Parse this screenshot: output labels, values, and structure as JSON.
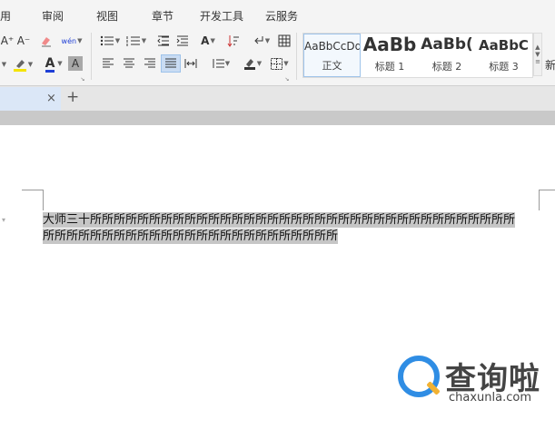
{
  "menubar": {
    "items": [
      "用",
      "审阅",
      "视图",
      "章节",
      "开发工具",
      "云服务"
    ]
  },
  "ribbon": {
    "increase_font_icon": "A⁺",
    "decrease_font_icon": "A⁻",
    "phonetic_icon": "wén",
    "bullets_icon": "bullet-list-icon",
    "numbering_icon": "numbered-list-icon",
    "font_color_letter": "A",
    "highlight_color": "#f4e400",
    "font_color": "#1f3fd6",
    "accent": "#2f8de4"
  },
  "styles": {
    "items": [
      {
        "sample": "AaBbCcDd",
        "label": "正文"
      },
      {
        "sample": "AaBb",
        "label": "标题 1"
      },
      {
        "sample": "AaBb(",
        "label": "标题 2"
      },
      {
        "sample": "AaBbC",
        "label": "标题 3"
      }
    ],
    "more_label": "新"
  },
  "tabs": {
    "close_label": "×",
    "add_label": "+"
  },
  "document": {
    "line1": "大师三十所所所所所所所所所所所所所所所所所所所所所所所所所所所所所所所所所所所所",
    "line2": "所所所所所所所所所所所所所所所所所所所所所所所所所"
  },
  "watermark": {
    "title": "查询啦",
    "url": "chaxunla.com"
  }
}
